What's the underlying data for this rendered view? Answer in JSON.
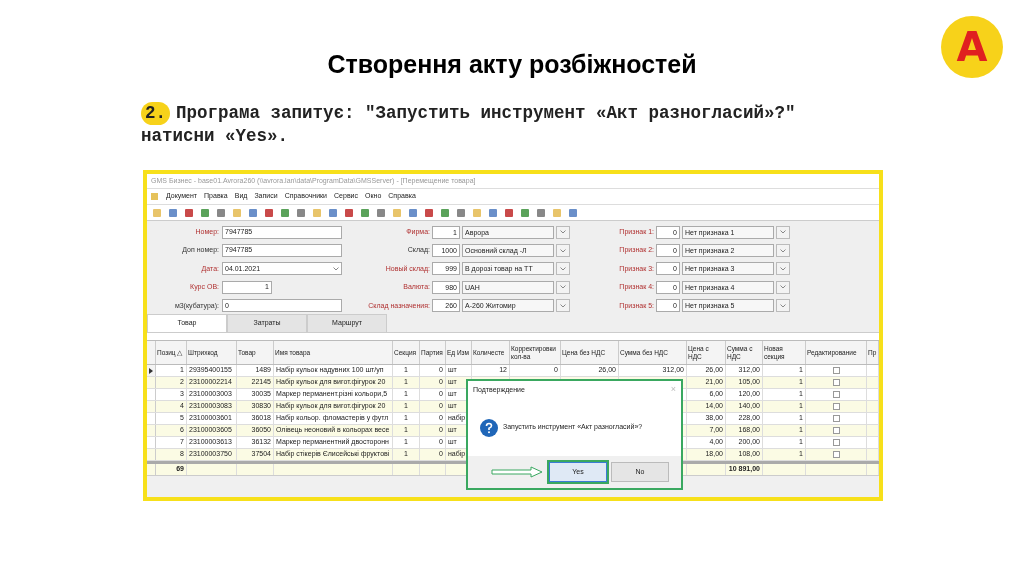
{
  "slide": {
    "title": "Створення акту розбіжностей",
    "badge": "A",
    "step_number": "2.",
    "instruction": "Програма запитує: \"Запустить инструмент «Акт разногласий»?\" натисни «Yes»."
  },
  "window": {
    "title": "GMS Бизнес - base01.Avrora260 (\\\\avrora.lan\\data\\ProgramData\\GMSServer) - [Перемещение товара]",
    "menu": [
      "Документ",
      "Правка",
      "Вид",
      "Записи",
      "Справочники",
      "Сервис",
      "Окно",
      "Справка"
    ]
  },
  "form": {
    "left": [
      {
        "label": "Номер:",
        "value": "7947785",
        "required": true,
        "kind": "text"
      },
      {
        "label": "Доп номер:",
        "value": "7947785",
        "required": false,
        "kind": "text"
      },
      {
        "label": "Дата:",
        "value": "04.01.2021",
        "required": true,
        "kind": "date"
      },
      {
        "label": "Курс ОВ:",
        "value": "1",
        "required": true,
        "kind": "number"
      },
      {
        "label": "м3(кубатура):",
        "value": "0",
        "required": false,
        "kind": "text"
      }
    ],
    "middle": [
      {
        "label": "Фирма:",
        "code": "1",
        "value": "Аврора",
        "required": true
      },
      {
        "label": "Склад:",
        "code": "1000",
        "value": "Основний склад -Л",
        "required": false
      },
      {
        "label": "Новый склад:",
        "code": "999",
        "value": "В дорозі товар на ТТ",
        "required": true
      },
      {
        "label": "Валюта:",
        "code": "980",
        "value": "UAH",
        "required": true
      },
      {
        "label": "Склад назначения:",
        "code": "260",
        "value": "А-260 Житомир",
        "required": true
      }
    ],
    "right": [
      {
        "label": "Признак 1:",
        "code": "0",
        "value": "Нет признака 1",
        "required": true
      },
      {
        "label": "Признак 2:",
        "code": "0",
        "value": "Нет признака 2",
        "required": true
      },
      {
        "label": "Признак 3:",
        "code": "0",
        "value": "Нет признака 3",
        "required": true
      },
      {
        "label": "Признак 4:",
        "code": "0",
        "value": "Нет признака 4",
        "required": true
      },
      {
        "label": "Признак 5:",
        "code": "0",
        "value": "Нет признака 5",
        "required": true
      }
    ]
  },
  "tabs": [
    {
      "label": "Товар",
      "selected": true
    },
    {
      "label": "Затраты",
      "selected": false
    },
    {
      "label": "Маршрут",
      "selected": false
    }
  ],
  "table": {
    "columns": [
      "Позиц △",
      "Штрихкод",
      "Товар",
      "Имя товара",
      "Секция",
      "Партия",
      "Ед Изм",
      "Количесте",
      "Корректировки кол-ва",
      "Цена без НДС",
      "Сумма без НДС",
      "Цена с НДС",
      "Сумма с НДС",
      "Новая секция",
      "Редактирование",
      "Пр"
    ],
    "rows": [
      {
        "current": true,
        "cells": [
          "1",
          "29395400155",
          "1489",
          "Набір кульок надувних 100 шт/уп",
          "1",
          "0",
          "шт",
          "12",
          "0",
          "26,00",
          "312,00",
          "26,00",
          "312,00",
          "1"
        ],
        "editing_checked": false
      },
      {
        "current": false,
        "cells": [
          "2",
          "23100002214",
          "22145",
          "Набір кульок для вигот.фігурок 20",
          "1",
          "0",
          "шт",
          null,
          null,
          null,
          null,
          "21,00",
          "105,00",
          "1"
        ],
        "editing_checked": false
      },
      {
        "current": false,
        "cells": [
          "3",
          "23100003003",
          "30035",
          "Маркер перманент.різні кольори,5",
          "1",
          "0",
          "шт",
          null,
          null,
          null,
          null,
          "6,00",
          "120,00",
          "1"
        ],
        "editing_checked": false
      },
      {
        "current": false,
        "cells": [
          "4",
          "23100003083",
          "30830",
          "Набір кульок для вигот.фігурок 20",
          "1",
          "0",
          "шт",
          null,
          null,
          null,
          null,
          "14,00",
          "140,00",
          "1"
        ],
        "editing_checked": false
      },
      {
        "current": false,
        "cells": [
          "5",
          "23100003601",
          "36018",
          "Набір кольор. фломастерів у футл",
          "1",
          "0",
          "набір",
          null,
          null,
          null,
          null,
          "38,00",
          "228,00",
          "1"
        ],
        "editing_checked": false
      },
      {
        "current": false,
        "cells": [
          "6",
          "23100003605",
          "36050",
          "Олівець неоновий в кольорах весе",
          "1",
          "0",
          "шт",
          null,
          null,
          null,
          null,
          "7,00",
          "168,00",
          "1"
        ],
        "editing_checked": false
      },
      {
        "current": false,
        "cells": [
          "7",
          "23100003613",
          "36132",
          "Маркер перманентний двосторонн",
          "1",
          "0",
          "шт",
          null,
          null,
          null,
          null,
          "4,00",
          "200,00",
          "1"
        ],
        "editing_checked": false
      },
      {
        "current": false,
        "cells": [
          "8",
          "23100003750",
          "37504",
          "Набір стікерів Єлисейські фруктові",
          "1",
          "0",
          "набір",
          null,
          null,
          null,
          null,
          "18,00",
          "108,00",
          "1"
        ],
        "editing_checked": false
      }
    ],
    "totals": {
      "position_count": "69",
      "sum_with_vat": "10 891,00"
    }
  },
  "dialog": {
    "title": "Подтверждение",
    "close": "×",
    "message": "Запустить инструмент «Акт разногласий»?",
    "buttons": [
      {
        "label": "Yes",
        "selected": true
      },
      {
        "label": "No",
        "selected": false
      }
    ]
  }
}
